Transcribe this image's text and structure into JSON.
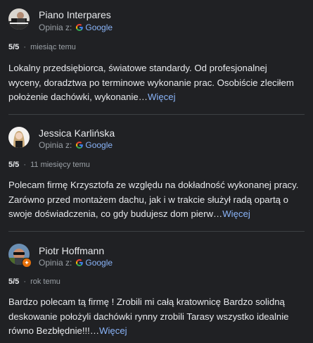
{
  "reviews": [
    {
      "author": "Piano Interpares",
      "source_prefix": "Opinia z:",
      "source_name": "Google",
      "rating": "5/5",
      "separator": "·",
      "time": "miesiąc temu",
      "text": "Lokalny przedsiębiorca, światowe standardy. Od profesjonalnej wyceny, doradztwa po terminowe wykonanie prac. Osobiście zleciłem położenie dachówki, wykonanie",
      "ellipsis": "…",
      "more_label": "Więcej",
      "avatar": "piano-avatar"
    },
    {
      "author": "Jessica Karlińska",
      "source_prefix": "Opinia z:",
      "source_name": "Google",
      "rating": "5/5",
      "separator": "·",
      "time": "11 miesięcy temu",
      "text": "Polecam firmę Krzysztofa ze względu na dokładność wykonanej pracy. Zarówno przed montażem dachu, jak i w trakcie służył radą opartą o swoje doświadczenia, co gdy budujesz dom pierw",
      "ellipsis": "…",
      "more_label": "Więcej",
      "avatar": "jessica-avatar"
    },
    {
      "author": "Piotr Hoffmann",
      "source_prefix": "Opinia z:",
      "source_name": "Google",
      "rating": "5/5",
      "separator": "·",
      "time": "rok temu",
      "text": "Bardzo polecam tą firmę ! Zrobili mi całą kratownicę Bardzo solidną deskowanie położyli dachówki rynny zrobili Tarasy wszystko idealnie równo Bezbłędnie!!!",
      "ellipsis": "…",
      "more_label": "Więcej",
      "avatar": "piotr-avatar",
      "local_guide_badge": "✦"
    }
  ],
  "colors": {
    "background": "#202124",
    "text": "#e8eaed",
    "muted": "#9aa0a6",
    "link": "#8ab4f8",
    "divider": "#3c4043",
    "badge": "#e8710a"
  }
}
